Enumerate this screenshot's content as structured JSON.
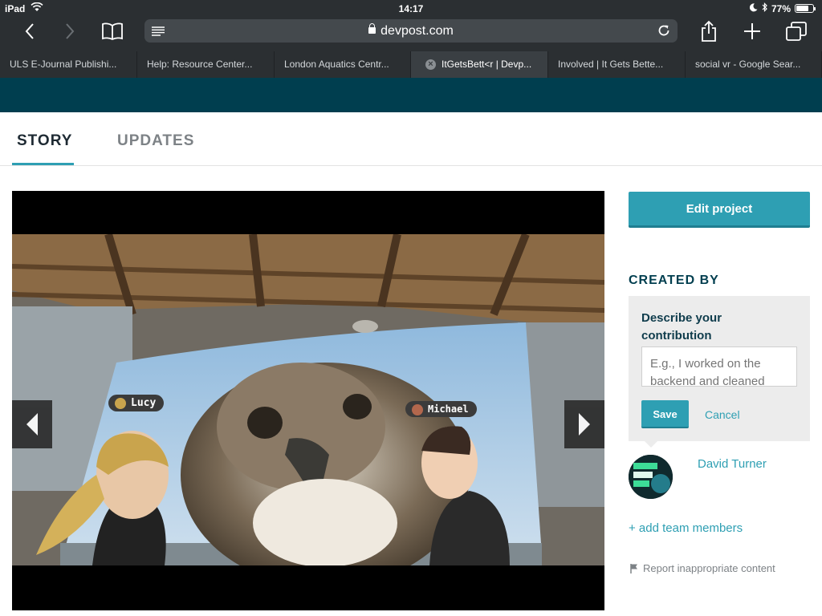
{
  "status_bar": {
    "device": "iPad",
    "time": "14:17",
    "battery": "77%",
    "battery_level": 0.77
  },
  "browser": {
    "address": "devpost.com",
    "tabs": [
      {
        "title": "ULS E-Journal Publishi..."
      },
      {
        "title": "Help: Resource Center..."
      },
      {
        "title": "London Aquatics Centr..."
      },
      {
        "title": "ItGetsBett<r | Devp...",
        "active": true
      },
      {
        "title": "Involved | It Gets Bette..."
      },
      {
        "title": "social vr - Google Sear..."
      }
    ]
  },
  "page_tabs": {
    "story": "STORY",
    "updates": "UPDATES"
  },
  "gallery": {
    "avatar_label_left": "Lucy",
    "avatar_label_right": "Michael"
  },
  "sidebar": {
    "edit_project": "Edit project",
    "created_by": "CREATED BY",
    "contribution_label": "Describe your contribution",
    "contribution_placeholder": "E.g., I worked on the backend and cleaned",
    "save": "Save",
    "cancel": "Cancel",
    "member_name": "David Turner",
    "add_team_members": "+ add team members",
    "report": "Report inappropriate content"
  },
  "colors": {
    "accent": "#2e9fb3",
    "brand_dark": "#003e4f",
    "browser_chrome": "#2b2f32"
  }
}
